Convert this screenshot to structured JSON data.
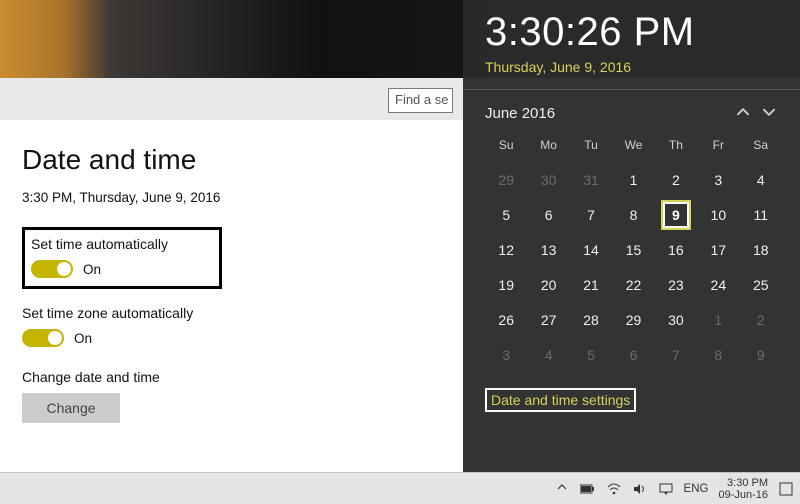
{
  "search": {
    "placeholder": "Find a se"
  },
  "settings": {
    "title": "Date and time",
    "clock_text": "3:30 PM, Thursday, June 9, 2016",
    "auto_time": {
      "label": "Set time automatically",
      "state": "On"
    },
    "auto_zone": {
      "label": "Set time zone automatically",
      "state": "On"
    },
    "change": {
      "label": "Change date and time",
      "button": "Change"
    }
  },
  "flyout": {
    "time": "3:30:26 PM",
    "date": "Thursday, June 9, 2016",
    "month_label": "June 2016",
    "weekdays": [
      "Su",
      "Mo",
      "Tu",
      "We",
      "Th",
      "Fr",
      "Sa"
    ],
    "weeks": [
      [
        {
          "d": "29",
          "dim": true
        },
        {
          "d": "30",
          "dim": true
        },
        {
          "d": "31",
          "dim": true
        },
        {
          "d": "1"
        },
        {
          "d": "2"
        },
        {
          "d": "3"
        },
        {
          "d": "4"
        }
      ],
      [
        {
          "d": "5"
        },
        {
          "d": "6"
        },
        {
          "d": "7"
        },
        {
          "d": "8"
        },
        {
          "d": "9",
          "today": true
        },
        {
          "d": "10"
        },
        {
          "d": "11"
        }
      ],
      [
        {
          "d": "12"
        },
        {
          "d": "13"
        },
        {
          "d": "14"
        },
        {
          "d": "15"
        },
        {
          "d": "16"
        },
        {
          "d": "17"
        },
        {
          "d": "18"
        }
      ],
      [
        {
          "d": "19"
        },
        {
          "d": "20"
        },
        {
          "d": "21"
        },
        {
          "d": "22"
        },
        {
          "d": "23"
        },
        {
          "d": "24"
        },
        {
          "d": "25"
        }
      ],
      [
        {
          "d": "26"
        },
        {
          "d": "27"
        },
        {
          "d": "28"
        },
        {
          "d": "29"
        },
        {
          "d": "30"
        },
        {
          "d": "1",
          "dim": true
        },
        {
          "d": "2",
          "dim": true
        }
      ],
      [
        {
          "d": "3",
          "dim": true
        },
        {
          "d": "4",
          "dim": true
        },
        {
          "d": "5",
          "dim": true
        },
        {
          "d": "6",
          "dim": true
        },
        {
          "d": "7",
          "dim": true
        },
        {
          "d": "8",
          "dim": true
        },
        {
          "d": "9",
          "dim": true
        }
      ]
    ],
    "link": "Date and time settings"
  },
  "taskbar": {
    "language": "ENG",
    "time": "3:30 PM",
    "date": "09-Jun-16"
  }
}
